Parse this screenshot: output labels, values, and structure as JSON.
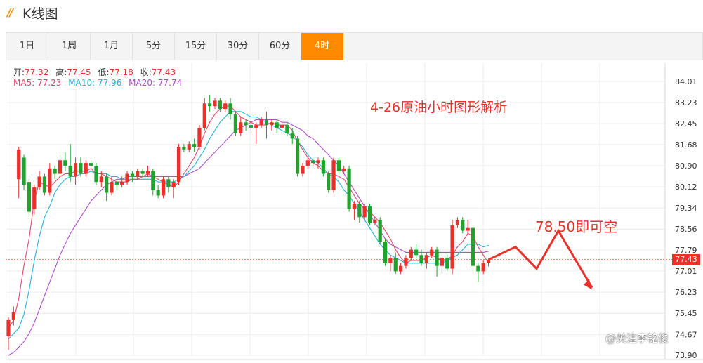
{
  "header": {
    "icon": "//",
    "title": "K线图"
  },
  "tabs": [
    {
      "label": "1日",
      "active": false
    },
    {
      "label": "1周",
      "active": false
    },
    {
      "label": "1月",
      "active": false
    },
    {
      "label": "5分",
      "active": false
    },
    {
      "label": "15分",
      "active": false
    },
    {
      "label": "30分",
      "active": false
    },
    {
      "label": "60分",
      "active": false
    },
    {
      "label": "4时",
      "active": true
    }
  ],
  "ohlc": {
    "open_label": "开:",
    "open": "77.32",
    "high_label": "高:",
    "high": "77.45",
    "low_label": "低:",
    "low": "77.18",
    "close_label": "收:",
    "close": "77.43"
  },
  "ma": {
    "ma5_label": "MA5:",
    "ma5": "77.23",
    "ma5_color": "#e6456c",
    "ma10_label": "MA10:",
    "ma10": "77.96",
    "ma10_color": "#26b4d8",
    "ma20_label": "MA20:",
    "ma20": "77.74",
    "ma20_color": "#b04fc8"
  },
  "annotations": {
    "title": "4-26原油小时图形解析",
    "short_level": "78.50即可空",
    "current_price": "77.43",
    "watermark": "关注李铭俊"
  },
  "colors": {
    "up": "#e8312b",
    "down": "#1fa32e",
    "accent": "#ff8a00",
    "annotation": "#e8312b"
  },
  "chart_data": {
    "type": "candlestick",
    "y_ticks": [
      "84.01",
      "83.23",
      "82.45",
      "81.68",
      "80.90",
      "80.12",
      "79.34",
      "78.56",
      "77.79",
      "77.01",
      "76.23",
      "75.45",
      "74.67",
      "73.90"
    ],
    "ylim": [
      73.9,
      84.01
    ],
    "current_price": 77.43,
    "candles": [
      [
        74.6,
        75.2,
        74.1,
        75.3
      ],
      [
        75.2,
        75.5,
        75.0,
        75.7
      ],
      [
        80.4,
        81.5,
        79.7,
        81.6
      ],
      [
        81.2,
        80.2,
        80.0,
        81.3
      ],
      [
        80.3,
        79.2,
        79.0,
        80.4
      ],
      [
        79.3,
        80.1,
        79.1,
        80.2
      ],
      [
        80.1,
        80.5,
        80.0,
        80.7
      ],
      [
        80.5,
        79.9,
        79.8,
        80.6
      ],
      [
        79.9,
        80.8,
        79.8,
        81.0
      ],
      [
        80.8,
        80.6,
        80.4,
        80.9
      ],
      [
        80.6,
        81.1,
        80.5,
        81.3
      ],
      [
        81.1,
        80.9,
        80.7,
        81.4
      ],
      [
        80.9,
        80.5,
        80.3,
        81.7
      ],
      [
        80.5,
        81.0,
        80.2,
        81.2
      ],
      [
        81.0,
        80.6,
        80.5,
        81.2
      ],
      [
        80.6,
        81.0,
        80.5,
        81.1
      ],
      [
        81.0,
        80.9,
        80.8,
        81.1
      ],
      [
        80.9,
        80.3,
        80.2,
        81.0
      ],
      [
        80.3,
        80.5,
        80.1,
        80.7
      ],
      [
        80.5,
        79.9,
        79.6,
        80.6
      ],
      [
        79.9,
        80.3,
        79.8,
        80.5
      ],
      [
        80.3,
        80.2,
        80.0,
        80.4
      ],
      [
        80.2,
        80.3,
        80.1,
        80.5
      ],
      [
        80.3,
        80.6,
        80.2,
        80.7
      ],
      [
        80.6,
        80.5,
        80.3,
        80.7
      ],
      [
        80.5,
        80.7,
        80.4,
        80.8
      ],
      [
        80.7,
        80.6,
        80.5,
        80.8
      ],
      [
        80.6,
        80.7,
        80.5,
        80.9
      ],
      [
        80.7,
        80.0,
        79.8,
        80.8
      ],
      [
        80.0,
        79.8,
        79.7,
        80.2
      ],
      [
        79.8,
        80.4,
        79.7,
        80.5
      ],
      [
        80.4,
        80.1,
        79.9,
        80.5
      ],
      [
        80.1,
        80.3,
        79.7,
        80.4
      ],
      [
        80.3,
        81.6,
        80.2,
        81.7
      ],
      [
        81.6,
        81.5,
        81.4,
        81.7
      ],
      [
        81.5,
        81.7,
        81.4,
        81.8
      ],
      [
        81.7,
        81.6,
        81.4,
        81.9
      ],
      [
        81.6,
        82.3,
        81.5,
        82.4
      ],
      [
        82.3,
        83.2,
        82.2,
        83.4
      ],
      [
        83.2,
        83.1,
        82.9,
        83.5
      ],
      [
        83.1,
        83.3,
        83.0,
        83.4
      ],
      [
        83.3,
        83.0,
        82.9,
        83.4
      ],
      [
        83.0,
        83.2,
        82.9,
        83.3
      ],
      [
        83.2,
        82.8,
        82.6,
        83.4
      ],
      [
        82.8,
        82.1,
        82.0,
        82.9
      ],
      [
        82.1,
        82.5,
        82.0,
        82.7
      ],
      [
        82.5,
        82.4,
        82.2,
        82.6
      ],
      [
        82.4,
        82.3,
        82.1,
        82.5
      ],
      [
        82.3,
        82.4,
        81.7,
        82.5
      ],
      [
        82.4,
        82.6,
        82.3,
        82.7
      ],
      [
        82.6,
        82.4,
        81.9,
        82.9
      ],
      [
        82.4,
        82.5,
        82.2,
        82.6
      ],
      [
        82.5,
        82.3,
        82.1,
        82.6
      ],
      [
        82.3,
        82.4,
        82.2,
        82.5
      ],
      [
        82.4,
        82.1,
        82.0,
        82.5
      ],
      [
        82.1,
        81.9,
        81.7,
        82.3
      ],
      [
        81.9,
        80.6,
        80.5,
        82.0
      ],
      [
        80.6,
        80.9,
        80.5,
        81.0
      ],
      [
        80.9,
        81.1,
        80.8,
        81.2
      ],
      [
        81.1,
        81.0,
        80.9,
        81.2
      ],
      [
        81.0,
        81.1,
        80.8,
        81.2
      ],
      [
        81.1,
        80.6,
        80.5,
        81.2
      ],
      [
        80.6,
        80.0,
        79.9,
        80.7
      ],
      [
        80.0,
        81.1,
        79.9,
        81.2
      ],
      [
        81.1,
        80.7,
        80.6,
        81.2
      ],
      [
        80.7,
        80.8,
        80.6,
        80.9
      ],
      [
        80.8,
        79.3,
        79.2,
        80.9
      ],
      [
        79.3,
        79.5,
        78.9,
        79.6
      ],
      [
        79.5,
        79.0,
        78.8,
        79.6
      ],
      [
        79.0,
        79.4,
        78.9,
        79.5
      ],
      [
        79.4,
        78.8,
        78.7,
        79.5
      ],
      [
        78.8,
        78.9,
        78.7,
        79.0
      ],
      [
        78.9,
        78.1,
        78.0,
        79.0
      ],
      [
        78.1,
        77.3,
        77.2,
        78.2
      ],
      [
        77.3,
        77.5,
        77.0,
        77.6
      ],
      [
        77.5,
        77.0,
        76.9,
        77.7
      ],
      [
        77.0,
        77.2,
        76.9,
        77.3
      ],
      [
        77.2,
        77.5,
        77.1,
        77.6
      ],
      [
        77.5,
        77.8,
        77.4,
        77.9
      ],
      [
        77.8,
        77.6,
        77.5,
        78.0
      ],
      [
        77.6,
        77.3,
        77.2,
        77.8
      ],
      [
        77.3,
        77.6,
        77.1,
        77.7
      ],
      [
        77.6,
        77.8,
        77.5,
        77.9
      ],
      [
        77.8,
        77.2,
        76.8,
        77.9
      ],
      [
        77.2,
        77.5,
        76.9,
        77.6
      ],
      [
        77.5,
        77.1,
        77.0,
        77.6
      ],
      [
        77.1,
        78.7,
        76.9,
        78.9
      ],
      [
        78.7,
        78.9,
        78.6,
        79.0
      ],
      [
        78.9,
        78.5,
        78.4,
        79.0
      ],
      [
        78.5,
        78.6,
        78.4,
        78.9
      ],
      [
        78.6,
        77.2,
        77.0,
        78.7
      ],
      [
        77.2,
        77.0,
        76.6,
        77.3
      ],
      [
        77.0,
        77.3,
        76.9,
        77.4
      ],
      [
        77.32,
        77.43,
        77.18,
        77.45
      ]
    ],
    "ma5": [
      74.9,
      75.2,
      76.0,
      77.2,
      78.2,
      79.6,
      80.3,
      80.2,
      80.1,
      80.3,
      80.5,
      80.6,
      80.6,
      80.7,
      80.7,
      80.7,
      80.8,
      80.6,
      80.6,
      80.5,
      80.4,
      80.3,
      80.3,
      80.3,
      80.4,
      80.4,
      80.5,
      80.6,
      80.5,
      80.4,
      80.3,
      80.2,
      80.1,
      80.3,
      80.6,
      80.9,
      81.2,
      81.6,
      82.1,
      82.5,
      82.8,
      83.0,
      83.1,
      83.1,
      82.9,
      82.7,
      82.6,
      82.5,
      82.4,
      82.4,
      82.4,
      82.5,
      82.4,
      82.4,
      82.4,
      82.2,
      81.8,
      81.5,
      81.2,
      81.0,
      80.9,
      80.7,
      80.6,
      80.6,
      80.5,
      80.4,
      80.1,
      79.8,
      79.5,
      79.3,
      79.2,
      79.0,
      78.8,
      78.5,
      78.2,
      77.8,
      77.5,
      77.3,
      77.4,
      77.4,
      77.4,
      77.5,
      77.6,
      77.5,
      77.4,
      77.4,
      77.6,
      77.9,
      78.1,
      78.4,
      78.3,
      77.9,
      77.6,
      77.3
    ],
    "ma10": [
      74.5,
      74.7,
      74.9,
      75.4,
      76.3,
      77.4,
      78.3,
      79.0,
      79.4,
      79.9,
      80.2,
      80.4,
      80.5,
      80.5,
      80.6,
      80.6,
      80.7,
      80.6,
      80.6,
      80.6,
      80.5,
      80.5,
      80.4,
      80.4,
      80.4,
      80.4,
      80.4,
      80.4,
      80.4,
      80.3,
      80.3,
      80.3,
      80.3,
      80.4,
      80.5,
      80.7,
      80.9,
      81.2,
      81.5,
      81.9,
      82.2,
      82.5,
      82.7,
      82.9,
      82.9,
      82.9,
      82.8,
      82.7,
      82.7,
      82.6,
      82.5,
      82.4,
      82.3,
      82.2,
      82.1,
      82.0,
      81.8,
      81.6,
      81.3,
      81.1,
      81.0,
      80.8,
      80.6,
      80.5,
      80.3,
      80.0,
      79.8,
      79.5,
      79.2,
      78.9,
      78.6,
      78.3,
      78.0,
      77.8,
      77.6,
      77.5,
      77.4,
      77.3,
      77.3,
      77.3,
      77.3,
      77.3,
      77.3,
      77.3,
      77.3,
      77.4,
      77.5,
      77.6,
      77.8,
      78.0,
      78.0,
      78.0,
      77.9,
      77.96
    ],
    "ma20": [
      73.9,
      74.0,
      74.2,
      74.4,
      74.7,
      75.1,
      75.6,
      76.1,
      76.6,
      77.1,
      77.6,
      78.0,
      78.4,
      78.7,
      79.0,
      79.3,
      79.6,
      79.8,
      80.0,
      80.2,
      80.3,
      80.4,
      80.4,
      80.5,
      80.5,
      80.5,
      80.5,
      80.5,
      80.5,
      80.5,
      80.5,
      80.5,
      80.5,
      80.5,
      80.5,
      80.6,
      80.7,
      80.8,
      81.0,
      81.2,
      81.4,
      81.6,
      81.8,
      82.0,
      82.2,
      82.3,
      82.4,
      82.5,
      82.6,
      82.6,
      82.6,
      82.6,
      82.6,
      82.5,
      82.5,
      82.4,
      82.3,
      82.2,
      82.0,
      81.9,
      81.7,
      81.5,
      81.3,
      81.1,
      80.9,
      80.6,
      80.3,
      80.0,
      79.7,
      79.4,
      79.1,
      78.8,
      78.5,
      78.2,
      78.0,
      77.9,
      77.8,
      77.7,
      77.7,
      77.7,
      77.7,
      77.7,
      77.7,
      77.7,
      77.7,
      77.7,
      77.7,
      77.7,
      77.7,
      77.7,
      77.7,
      77.7,
      77.7,
      77.74
    ],
    "projection": [
      77.43,
      77.9,
      77.1,
      78.5,
      76.4
    ]
  }
}
